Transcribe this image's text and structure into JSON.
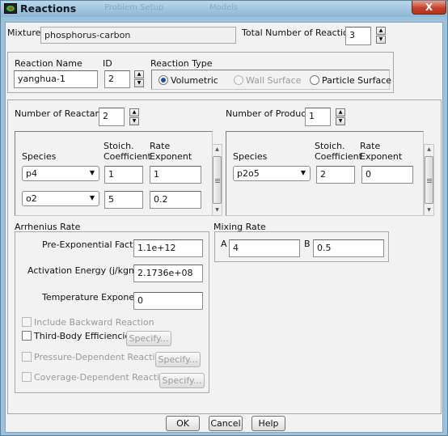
{
  "window": {
    "title": "Reactions",
    "close": "X",
    "bg_title_1": "Problem Setup",
    "bg_title_2": "Models"
  },
  "mixture": {
    "label": "Mixture",
    "value": "phosphorus-carbon"
  },
  "total_reactions": {
    "label": "Total Number of Reactions",
    "value": "3"
  },
  "reaction": {
    "name_label": "Reaction Name",
    "name_value": "yanghua-1",
    "id_label": "ID",
    "id_value": "2",
    "type_label": "Reaction Type",
    "types": [
      "Volumetric",
      "Wall Surface",
      "Particle Surface"
    ],
    "selected_type": "Volumetric"
  },
  "reactants": {
    "count_label": "Number of Reactants",
    "count": "2",
    "col_species": "Species",
    "col_stoich": "Stoich.\nCoefficient",
    "col_rate": "Rate\nExponent",
    "rows": [
      {
        "species": "p4",
        "stoich": "1",
        "rate": "1"
      },
      {
        "species": "o2",
        "stoich": "5",
        "rate": "0.2"
      }
    ]
  },
  "products": {
    "count_label": "Number of Products",
    "count": "1",
    "col_species": "Species",
    "col_stoich": "Stoich.\nCoefficient",
    "col_rate": "Rate\nExponent",
    "rows": [
      {
        "species": "p2o5",
        "stoich": "2",
        "rate": "0"
      }
    ]
  },
  "arrhenius": {
    "title": "Arrhenius Rate",
    "pre_exp_label": "Pre-Exponential Factor",
    "pre_exp_value": "1.1e+12",
    "act_energy_label": "Activation Energy (j/kgmol)",
    "act_energy_value": "2.1736e+08",
    "temp_exp_label": "Temperature Exponent",
    "temp_exp_value": "0",
    "include_backward": "Include Backward Reaction",
    "third_body": "Third-Body Efficiencies",
    "pressure_dep": "Pressure-Dependent Reaction",
    "coverage_dep": "Coverage-Dependent Reaction",
    "specify": "Specify..."
  },
  "mixing": {
    "title": "Mixing Rate",
    "a_label": "A",
    "a_value": "4",
    "b_label": "B",
    "b_value": "0.5"
  },
  "buttons": {
    "ok": "OK",
    "cancel": "Cancel",
    "help": "Help"
  },
  "icons": {
    "dropdown": "chevron-down-icon",
    "spin_up": "spin-up-icon",
    "spin_down": "spin-down-icon",
    "app": "fluent-app-icon"
  }
}
